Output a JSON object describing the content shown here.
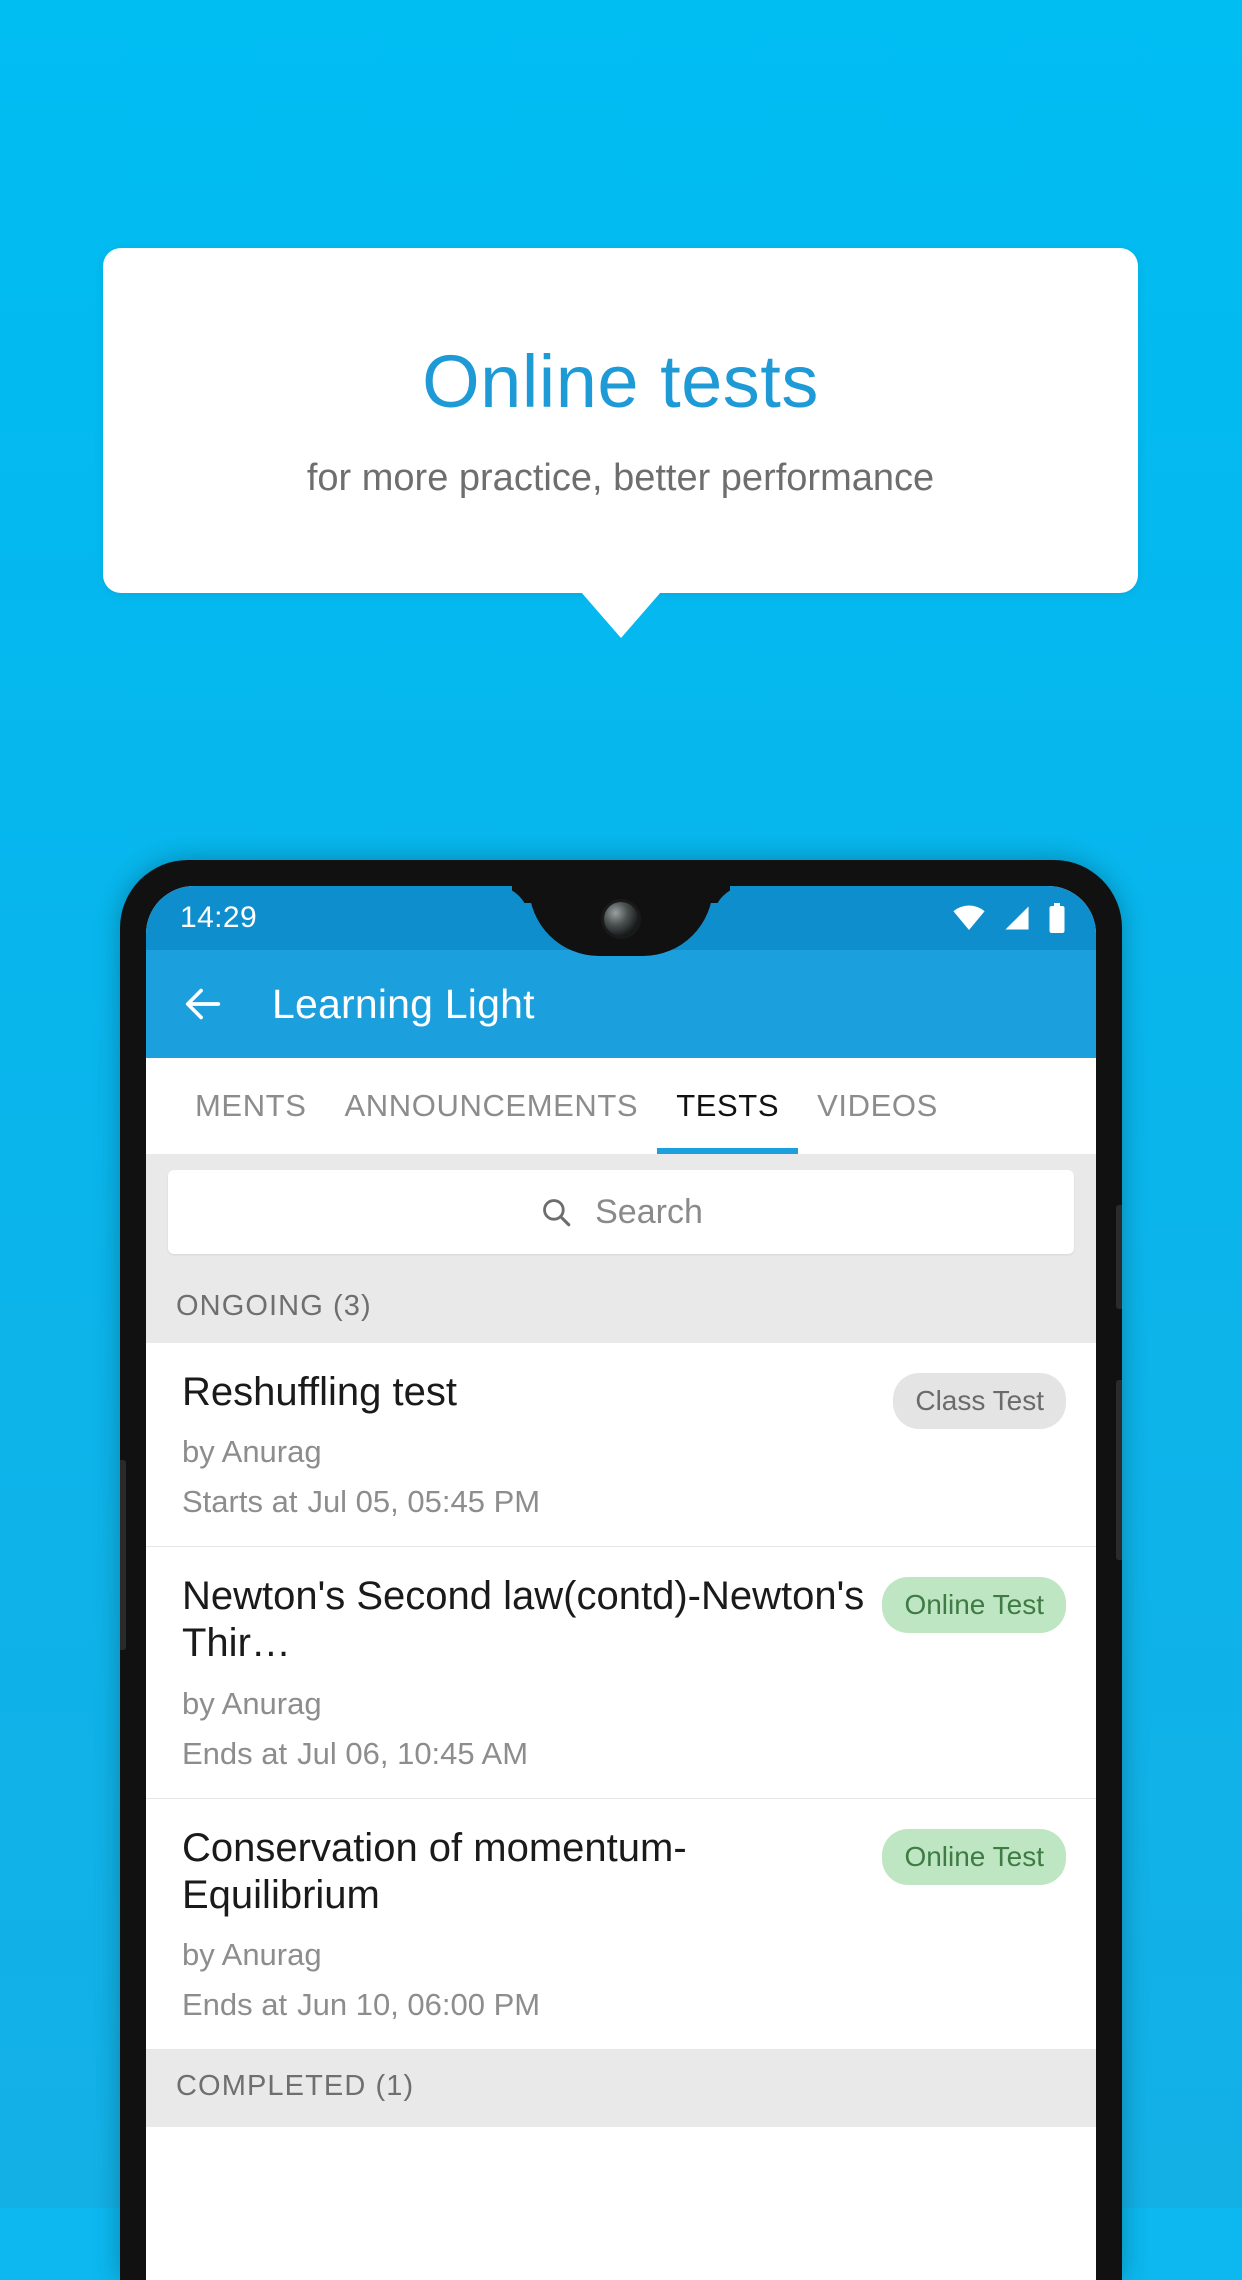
{
  "tooltip": {
    "title": "Online tests",
    "subtitle": "for more practice, better performance",
    "accent_color": "#1e9ad6",
    "background_color": "#00bdf2"
  },
  "phone": {
    "status_bar": {
      "time": "14:29",
      "icons": [
        "wifi-icon",
        "signal-icon",
        "battery-icon"
      ]
    },
    "app_bar": {
      "back_label": "back-arrow-icon",
      "title": "Learning Light"
    },
    "tabs": [
      {
        "label": "MENTS",
        "active": false
      },
      {
        "label": "ANNOUNCEMENTS",
        "active": false
      },
      {
        "label": "TESTS",
        "active": true
      },
      {
        "label": "VIDEOS",
        "active": false
      }
    ],
    "search": {
      "placeholder": "Search",
      "icon": "search-icon"
    },
    "sections": [
      {
        "header": "ONGOING (3)",
        "items": [
          {
            "title": "Reshuffling test",
            "author": "by Anurag",
            "when_label": "Starts at",
            "when_value": "Jul 05, 05:45 PM",
            "badge": "Class Test",
            "badge_type": "gray"
          },
          {
            "title": "Newton's Second law(contd)-Newton's Thir…",
            "author": "by Anurag",
            "when_label": "Ends at",
            "when_value": "Jul 06, 10:45 AM",
            "badge": "Online Test",
            "badge_type": "green"
          },
          {
            "title": "Conservation of momentum-Equilibrium",
            "author": "by Anurag",
            "when_label": "Ends at",
            "when_value": "Jun 10, 06:00 PM",
            "badge": "Online Test",
            "badge_type": "green"
          }
        ]
      },
      {
        "header": "COMPLETED (1)",
        "items": []
      }
    ]
  }
}
